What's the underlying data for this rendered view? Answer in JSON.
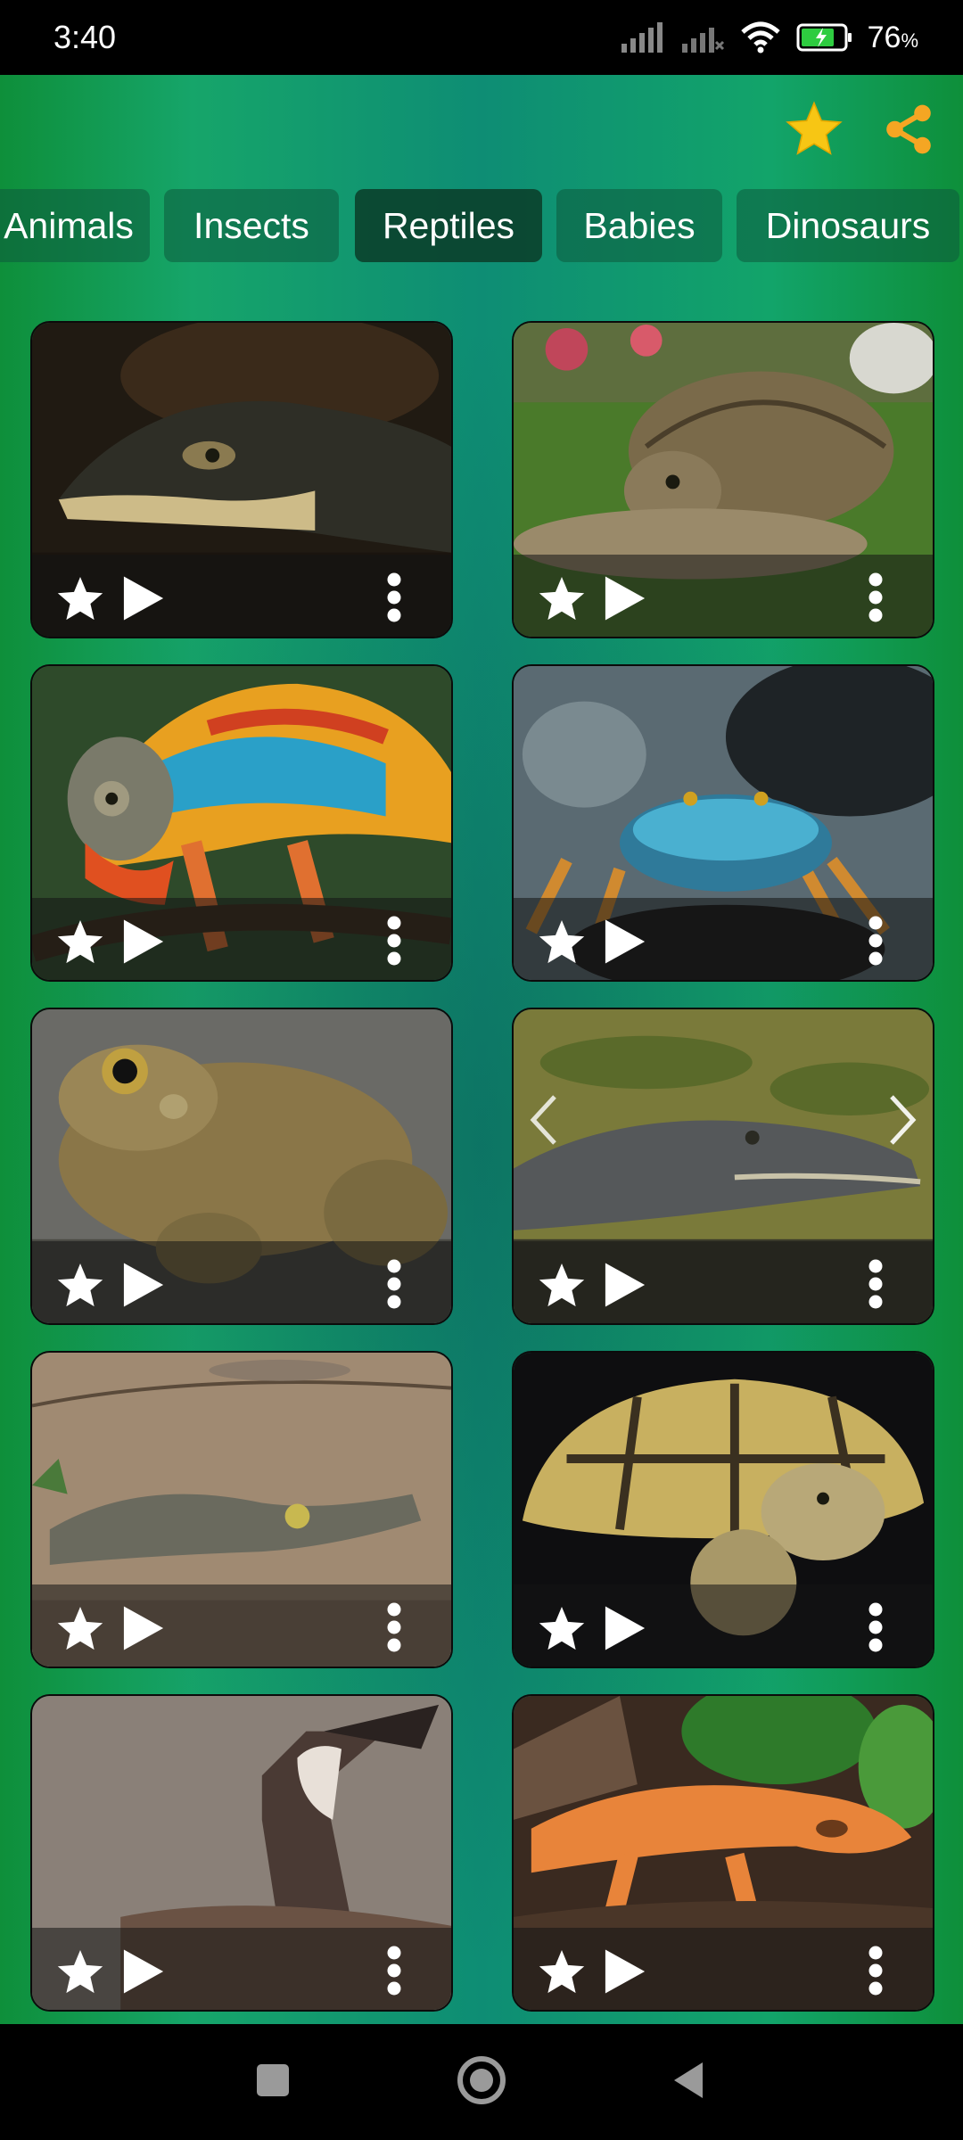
{
  "status": {
    "time": "3:40",
    "battery": "76",
    "battery_unit": "%"
  },
  "toolbar": {
    "favorites_icon": "star-icon",
    "share_icon": "share-icon",
    "accent": "#f7c614"
  },
  "tabs": [
    {
      "label": "Animals",
      "active": false
    },
    {
      "label": "Insects",
      "active": false
    },
    {
      "label": "Reptiles",
      "active": true
    },
    {
      "label": "Babies",
      "active": false
    },
    {
      "label": "Dinosaurs",
      "active": false
    }
  ],
  "cards": [
    {
      "subject": "alligator"
    },
    {
      "subject": "tortoise"
    },
    {
      "subject": "chameleon"
    },
    {
      "subject": "crab"
    },
    {
      "subject": "toad"
    },
    {
      "subject": "crocodile"
    },
    {
      "subject": "caiman"
    },
    {
      "subject": "tortoise"
    },
    {
      "subject": "frilled-lizard"
    },
    {
      "subject": "crested-gecko"
    }
  ],
  "card_actions": {
    "favorite_icon": "star-icon",
    "play_icon": "play-icon",
    "more_icon": "more-vertical-icon"
  },
  "colors": {
    "background_green": "#0e8f3a",
    "tab_bg": "#0c5a3c",
    "tab_active_bg": "#0a3c28"
  }
}
